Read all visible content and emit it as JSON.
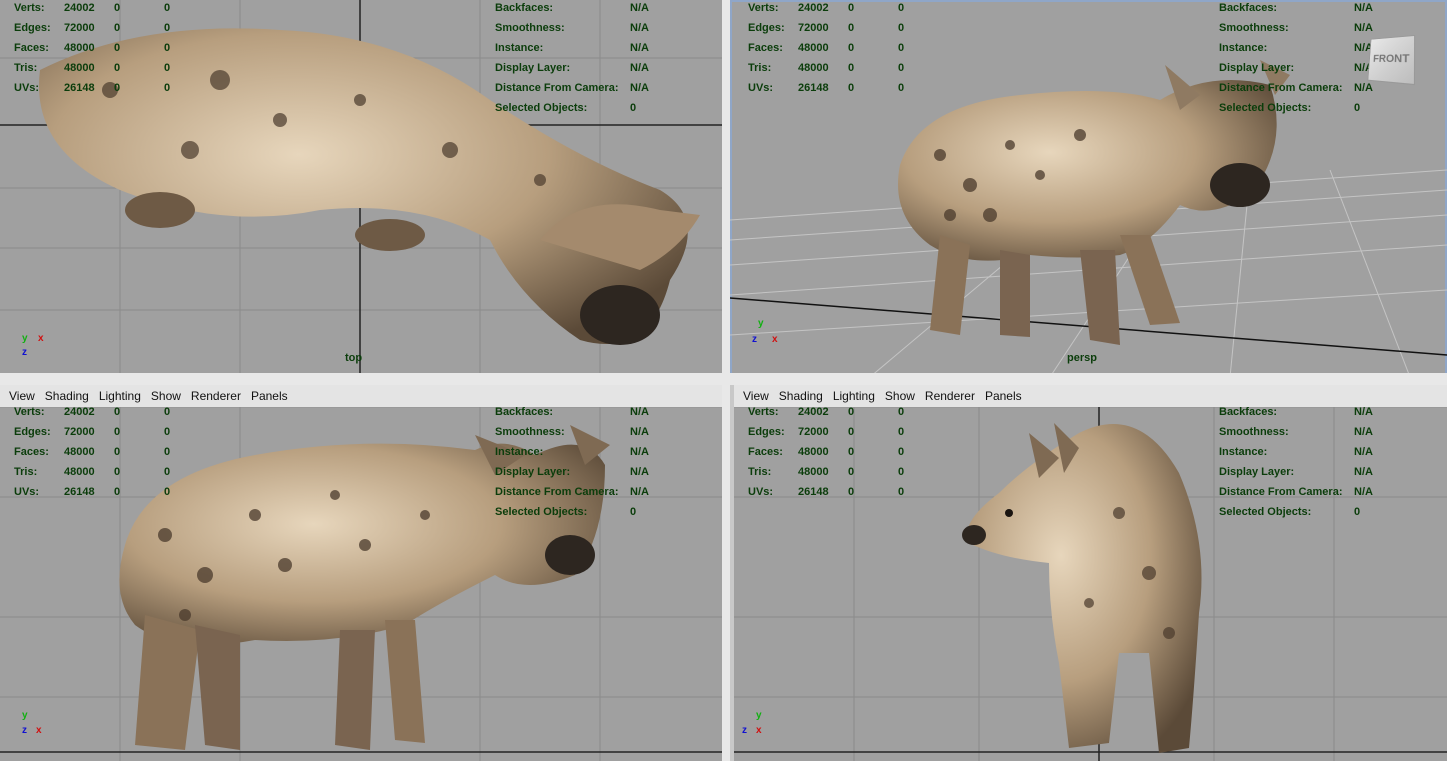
{
  "menu": [
    "View",
    "Shading",
    "Lighting",
    "Show",
    "Renderer",
    "Panels"
  ],
  "hud_left": [
    {
      "label": "Verts:",
      "v1": "24002",
      "v2": "0",
      "v3": "0"
    },
    {
      "label": "Edges:",
      "v1": "72000",
      "v2": "0",
      "v3": "0"
    },
    {
      "label": "Faces:",
      "v1": "48000",
      "v2": "0",
      "v3": "0"
    },
    {
      "label": "Tris:",
      "v1": "48000",
      "v2": "0",
      "v3": "0"
    },
    {
      "label": "UVs:",
      "v1": "26148",
      "v2": "0",
      "v3": "0"
    }
  ],
  "hud_right": [
    {
      "label": "Backfaces:",
      "value": "N/A"
    },
    {
      "label": "Smoothness:",
      "value": "N/A"
    },
    {
      "label": "Instance:",
      "value": "N/A"
    },
    {
      "label": "Display Layer:",
      "value": "N/A"
    },
    {
      "label": "Distance From Camera:",
      "value": "N/A"
    },
    {
      "label": "Selected Objects:",
      "value": "0"
    }
  ],
  "viewports": {
    "top": {
      "camera": "top"
    },
    "persp": {
      "camera": "persp",
      "view_cube": "FRONT"
    }
  },
  "axes": {
    "x": "x",
    "y": "y",
    "z": "z"
  },
  "colors": {
    "viewport_bg": "#a0a0a0",
    "hud_text": "#0b3d0b",
    "axis_x": "#d01010",
    "axis_y": "#10b010",
    "axis_z": "#1010d0"
  }
}
